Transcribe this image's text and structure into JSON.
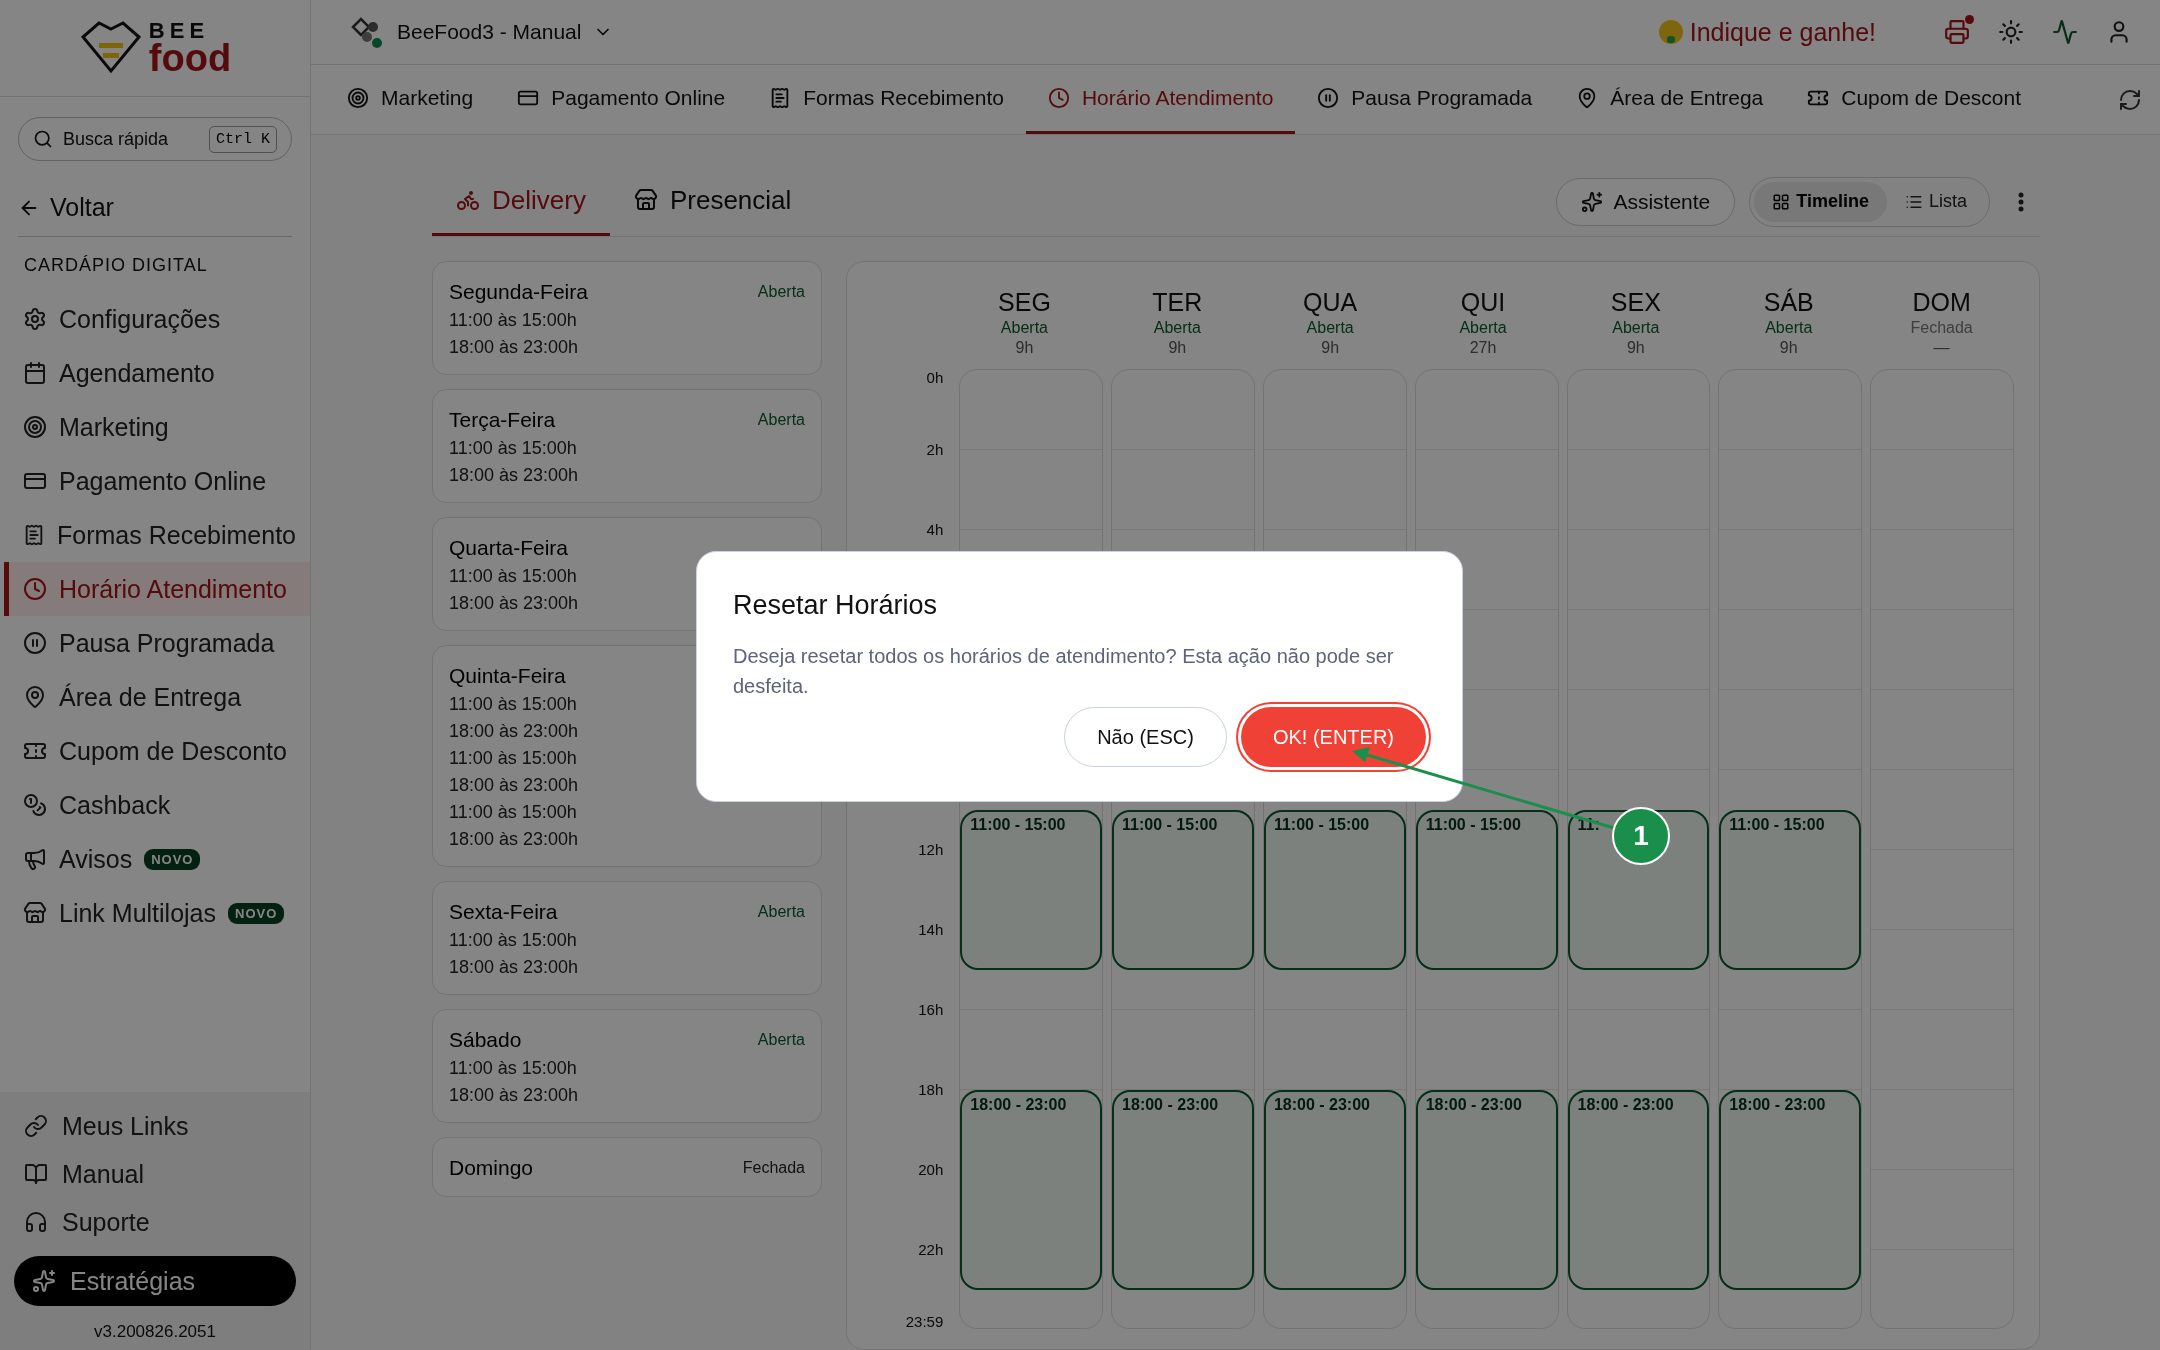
{
  "brand": {
    "logo_top": "BEE",
    "logo_bottom": "food"
  },
  "store": {
    "name": "BeeFood3 - Manual"
  },
  "header": {
    "promo": "Indique e ganhe!"
  },
  "search": {
    "placeholder": "Busca rápida",
    "shortcut": "Ctrl K"
  },
  "back": "Voltar",
  "sidebar": {
    "section": "CARDÁPIO DIGITAL",
    "items": [
      {
        "label": "Configurações",
        "selected": false
      },
      {
        "label": "Agendamento",
        "selected": false
      },
      {
        "label": "Marketing",
        "selected": false
      },
      {
        "label": "Pagamento Online",
        "selected": false
      },
      {
        "label": "Formas Recebimento",
        "selected": false
      },
      {
        "label": "Horário Atendimento",
        "selected": true
      },
      {
        "label": "Pausa Programada",
        "selected": false
      },
      {
        "label": "Área de Entrega",
        "selected": false
      },
      {
        "label": "Cupom de Desconto",
        "selected": false
      },
      {
        "label": "Cashback",
        "selected": false
      },
      {
        "label": "Avisos",
        "selected": false,
        "badge": "NOVO"
      },
      {
        "label": "Link Multilojas",
        "selected": false,
        "badge": "NOVO"
      }
    ]
  },
  "footer_links": [
    "Meus Links",
    "Manual",
    "Suporte"
  ],
  "strategies": "Estratégias",
  "version": "v3.200826.2051",
  "top_tabs": [
    {
      "label": "Marketing",
      "selected": false
    },
    {
      "label": "Pagamento Online",
      "selected": false
    },
    {
      "label": "Formas Recebimento",
      "selected": false
    },
    {
      "label": "Horário Atendimento",
      "selected": true
    },
    {
      "label": "Pausa Programada",
      "selected": false
    },
    {
      "label": "Área de Entrega",
      "selected": false
    },
    {
      "label": "Cupom de Descont",
      "selected": false
    }
  ],
  "mode_tabs": [
    {
      "label": "Delivery",
      "selected": true
    },
    {
      "label": "Presencial",
      "selected": false
    }
  ],
  "toolbar": {
    "assistant": "Assistente",
    "views": [
      {
        "label": "Timeline",
        "selected": true
      },
      {
        "label": "Lista",
        "selected": false
      }
    ]
  },
  "days": [
    {
      "name": "Segunda-Feira",
      "status": "Aberta",
      "open": true,
      "ranges": [
        "11:00 às 15:00h",
        "18:00 às 23:00h"
      ]
    },
    {
      "name": "Terça-Feira",
      "status": "Aberta",
      "open": true,
      "ranges": [
        "11:00 às 15:00h",
        "18:00 às 23:00h"
      ]
    },
    {
      "name": "Quarta-Feira",
      "ranges": [
        "11:00 às 15:00h",
        "18:00 às 23:00h"
      ]
    },
    {
      "name": "Quinta-Feira",
      "ranges": [
        "11:00 às 15:00h",
        "18:00 às 23:00h",
        "11:00 às 15:00h",
        "18:00 às 23:00h",
        "11:00 às 15:00h",
        "18:00 às 23:00h"
      ]
    },
    {
      "name": "Sexta-Feira",
      "status": "Aberta",
      "open": true,
      "ranges": [
        "11:00 às 15:00h",
        "18:00 às 23:00h"
      ]
    },
    {
      "name": "Sábado",
      "status": "Aberta",
      "open": true,
      "ranges": [
        "11:00 às 15:00h",
        "18:00 às 23:00h"
      ]
    },
    {
      "name": "Domingo",
      "status": "Fechada",
      "open": false
    }
  ],
  "timeline": {
    "hour_labels": [
      "0h",
      "2h",
      "4h",
      "12h",
      "14h",
      "16h",
      "18h",
      "20h",
      "22h",
      "23:59"
    ],
    "columns": [
      {
        "day": "SEG",
        "status": "Aberta",
        "open": true,
        "total": "9h",
        "blocks": [
          "11:00 - 15:00",
          "18:00 - 23:00"
        ]
      },
      {
        "day": "TER",
        "status": "Aberta",
        "open": true,
        "total": "9h",
        "blocks": [
          "11:00 - 15:00",
          "18:00 - 23:00"
        ]
      },
      {
        "day": "QUA",
        "status": "Aberta",
        "open": true,
        "total": "9h",
        "blocks": [
          "11:00 - 15:00",
          "18:00 - 23:00"
        ]
      },
      {
        "day": "QUI",
        "status": "Aberta",
        "open": true,
        "total": "27h",
        "blocks": [
          "11:00 - 15:00",
          "18:00 - 23:00"
        ]
      },
      {
        "day": "SEX",
        "status": "Aberta",
        "open": true,
        "total": "9h",
        "blocks": [
          "11:",
          "18:00 - 23:00"
        ]
      },
      {
        "day": "SÁB",
        "status": "Aberta",
        "open": true,
        "total": "9h",
        "blocks": [
          "11:00 - 15:00",
          "18:00 - 23:00"
        ]
      },
      {
        "day": "DOM",
        "status": "Fechada",
        "open": false,
        "total": "—"
      }
    ]
  },
  "modal": {
    "title": "Resetar Horários",
    "message": "Deseja resetar todos os horários de atendimento? Esta ação não pode ser desfeita.",
    "buttons": [
      {
        "label": "Não (ESC)",
        "kind": "secondary"
      },
      {
        "label": "OK! (ENTER)",
        "kind": "primary"
      }
    ]
  },
  "callouts": [
    {
      "number": "1"
    }
  ]
}
